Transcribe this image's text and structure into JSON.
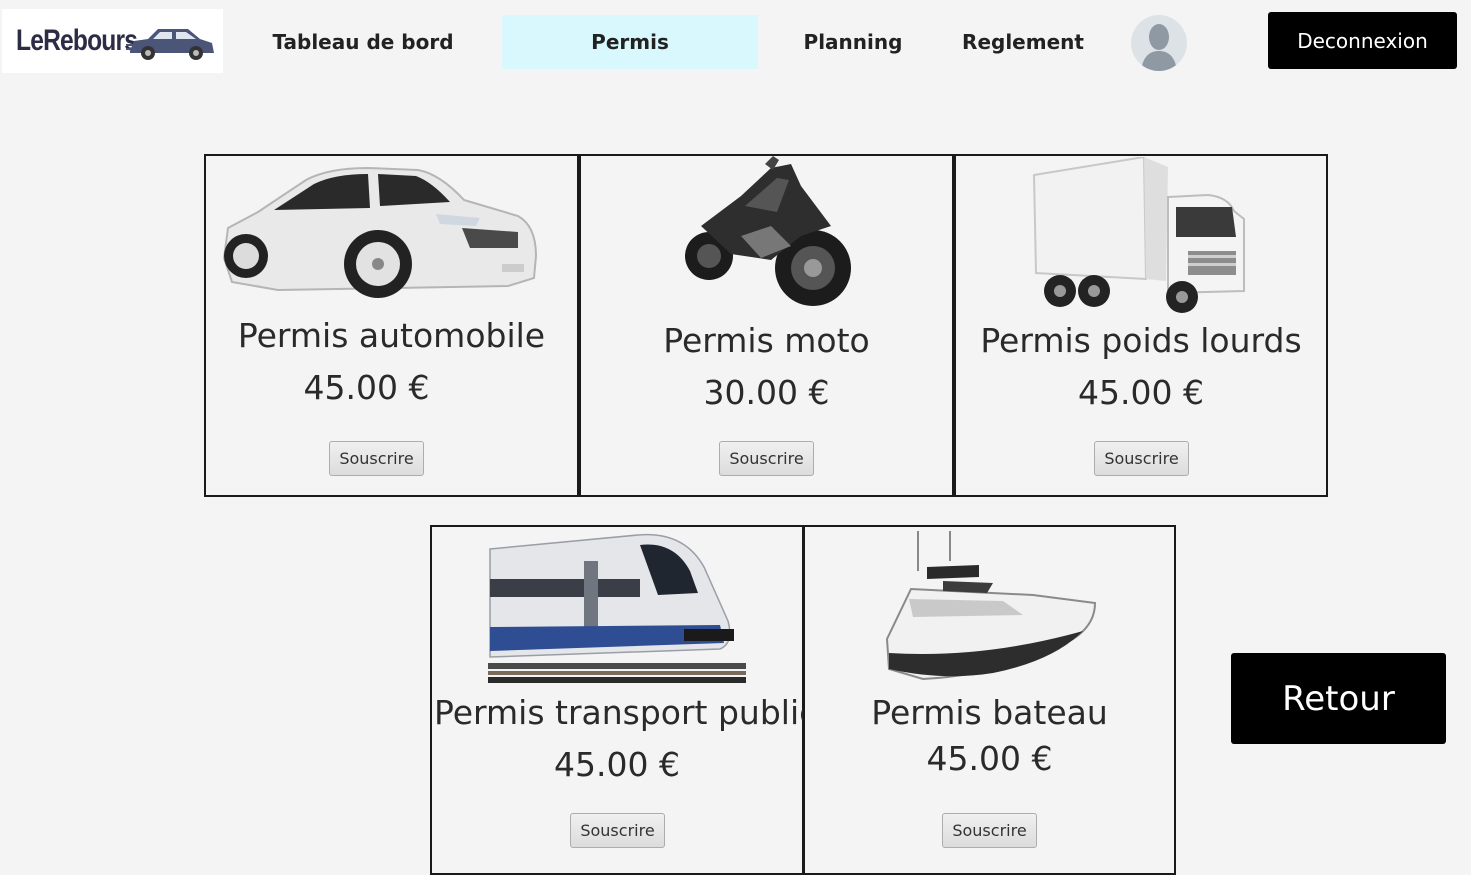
{
  "brand": {
    "name": "LeRebours",
    "logo_icon": "car-icon"
  },
  "nav": {
    "items": [
      {
        "label": "Tableau de bord"
      },
      {
        "label": "Permis",
        "active": true
      },
      {
        "label": "Planning"
      },
      {
        "label": "Reglement"
      }
    ],
    "avatar_icon": "user-avatar-icon",
    "logout_label": "Deconnexion"
  },
  "cards": [
    {
      "title": "Permis automobile",
      "price": "45.00 €",
      "button": "Souscrire",
      "image": "car-icon"
    },
    {
      "title": "Permis moto",
      "price": "30.00 €",
      "button": "Souscrire",
      "image": "motorcycle-icon"
    },
    {
      "title": "Permis poids lourds",
      "price": "45.00 €",
      "button": "Souscrire",
      "image": "truck-icon"
    },
    {
      "title": "Permis transport public",
      "price": "45.00 €",
      "button": "Souscrire",
      "image": "train-icon"
    },
    {
      "title": "Permis bateau",
      "price": "45.00 €",
      "button": "Souscrire",
      "image": "boat-icon"
    }
  ],
  "back_label": "Retour",
  "colors": {
    "active_tab": "#d9f8fd",
    "button_dark": "#000000",
    "background": "#f4f4f4"
  }
}
